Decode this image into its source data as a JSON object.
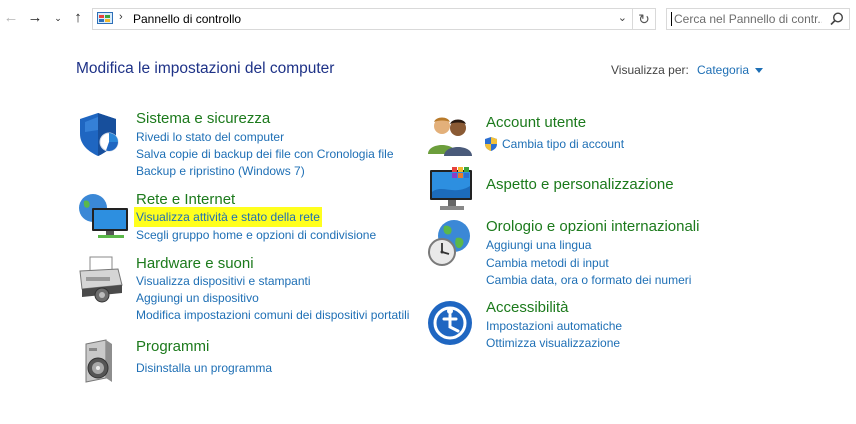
{
  "nav": {
    "address": "Pannello di controllo",
    "search_placeholder": "Cerca nel Pannello di contr..."
  },
  "header": {
    "title": "Modifica le impostazioni del computer",
    "view_by_label": "Visualizza per:",
    "view_by_value": "Categoria"
  },
  "categories": [
    {
      "heading": "Sistema e sicurezza",
      "icon": "shield-icon",
      "links": [
        "Rivedi lo stato del computer",
        "Salva copie di backup dei file con Cronologia file",
        "Backup e ripristino (Windows 7)"
      ]
    },
    {
      "heading": "Rete e Internet",
      "icon": "network-icon",
      "links": [
        "Visualizza attività e stato della rete",
        "Scegli gruppo home e opzioni di condivisione"
      ]
    },
    {
      "heading": "Hardware e suoni",
      "icon": "printer-icon",
      "links": [
        "Visualizza dispositivi e stampanti",
        "Aggiungi un dispositivo",
        "Modifica impostazioni comuni dei dispositivi portatili"
      ]
    },
    {
      "heading": "Programmi",
      "icon": "programs-icon",
      "links": [
        "Disinstalla un programma"
      ]
    },
    {
      "heading": "Account utente",
      "icon": "users-icon",
      "links": [
        "Cambia tipo di account"
      ]
    },
    {
      "heading": "Aspetto e personalizzazione",
      "icon": "monitor-icon",
      "links": []
    },
    {
      "heading": "Orologio e opzioni internazionali",
      "icon": "clock-globe-icon",
      "links": [
        "Aggiungi una lingua",
        "Cambia metodi di input",
        "Cambia data, ora o formato dei numeri"
      ]
    },
    {
      "heading": "Accessibilità",
      "icon": "accessibility-icon",
      "links": [
        "Impostazioni automatiche",
        "Ottimizza visualizzazione"
      ]
    }
  ],
  "colors": {
    "heading": "#1c7a1c",
    "link": "#1e6fb5",
    "title": "#1e3287",
    "highlight": "#ffff1e"
  }
}
